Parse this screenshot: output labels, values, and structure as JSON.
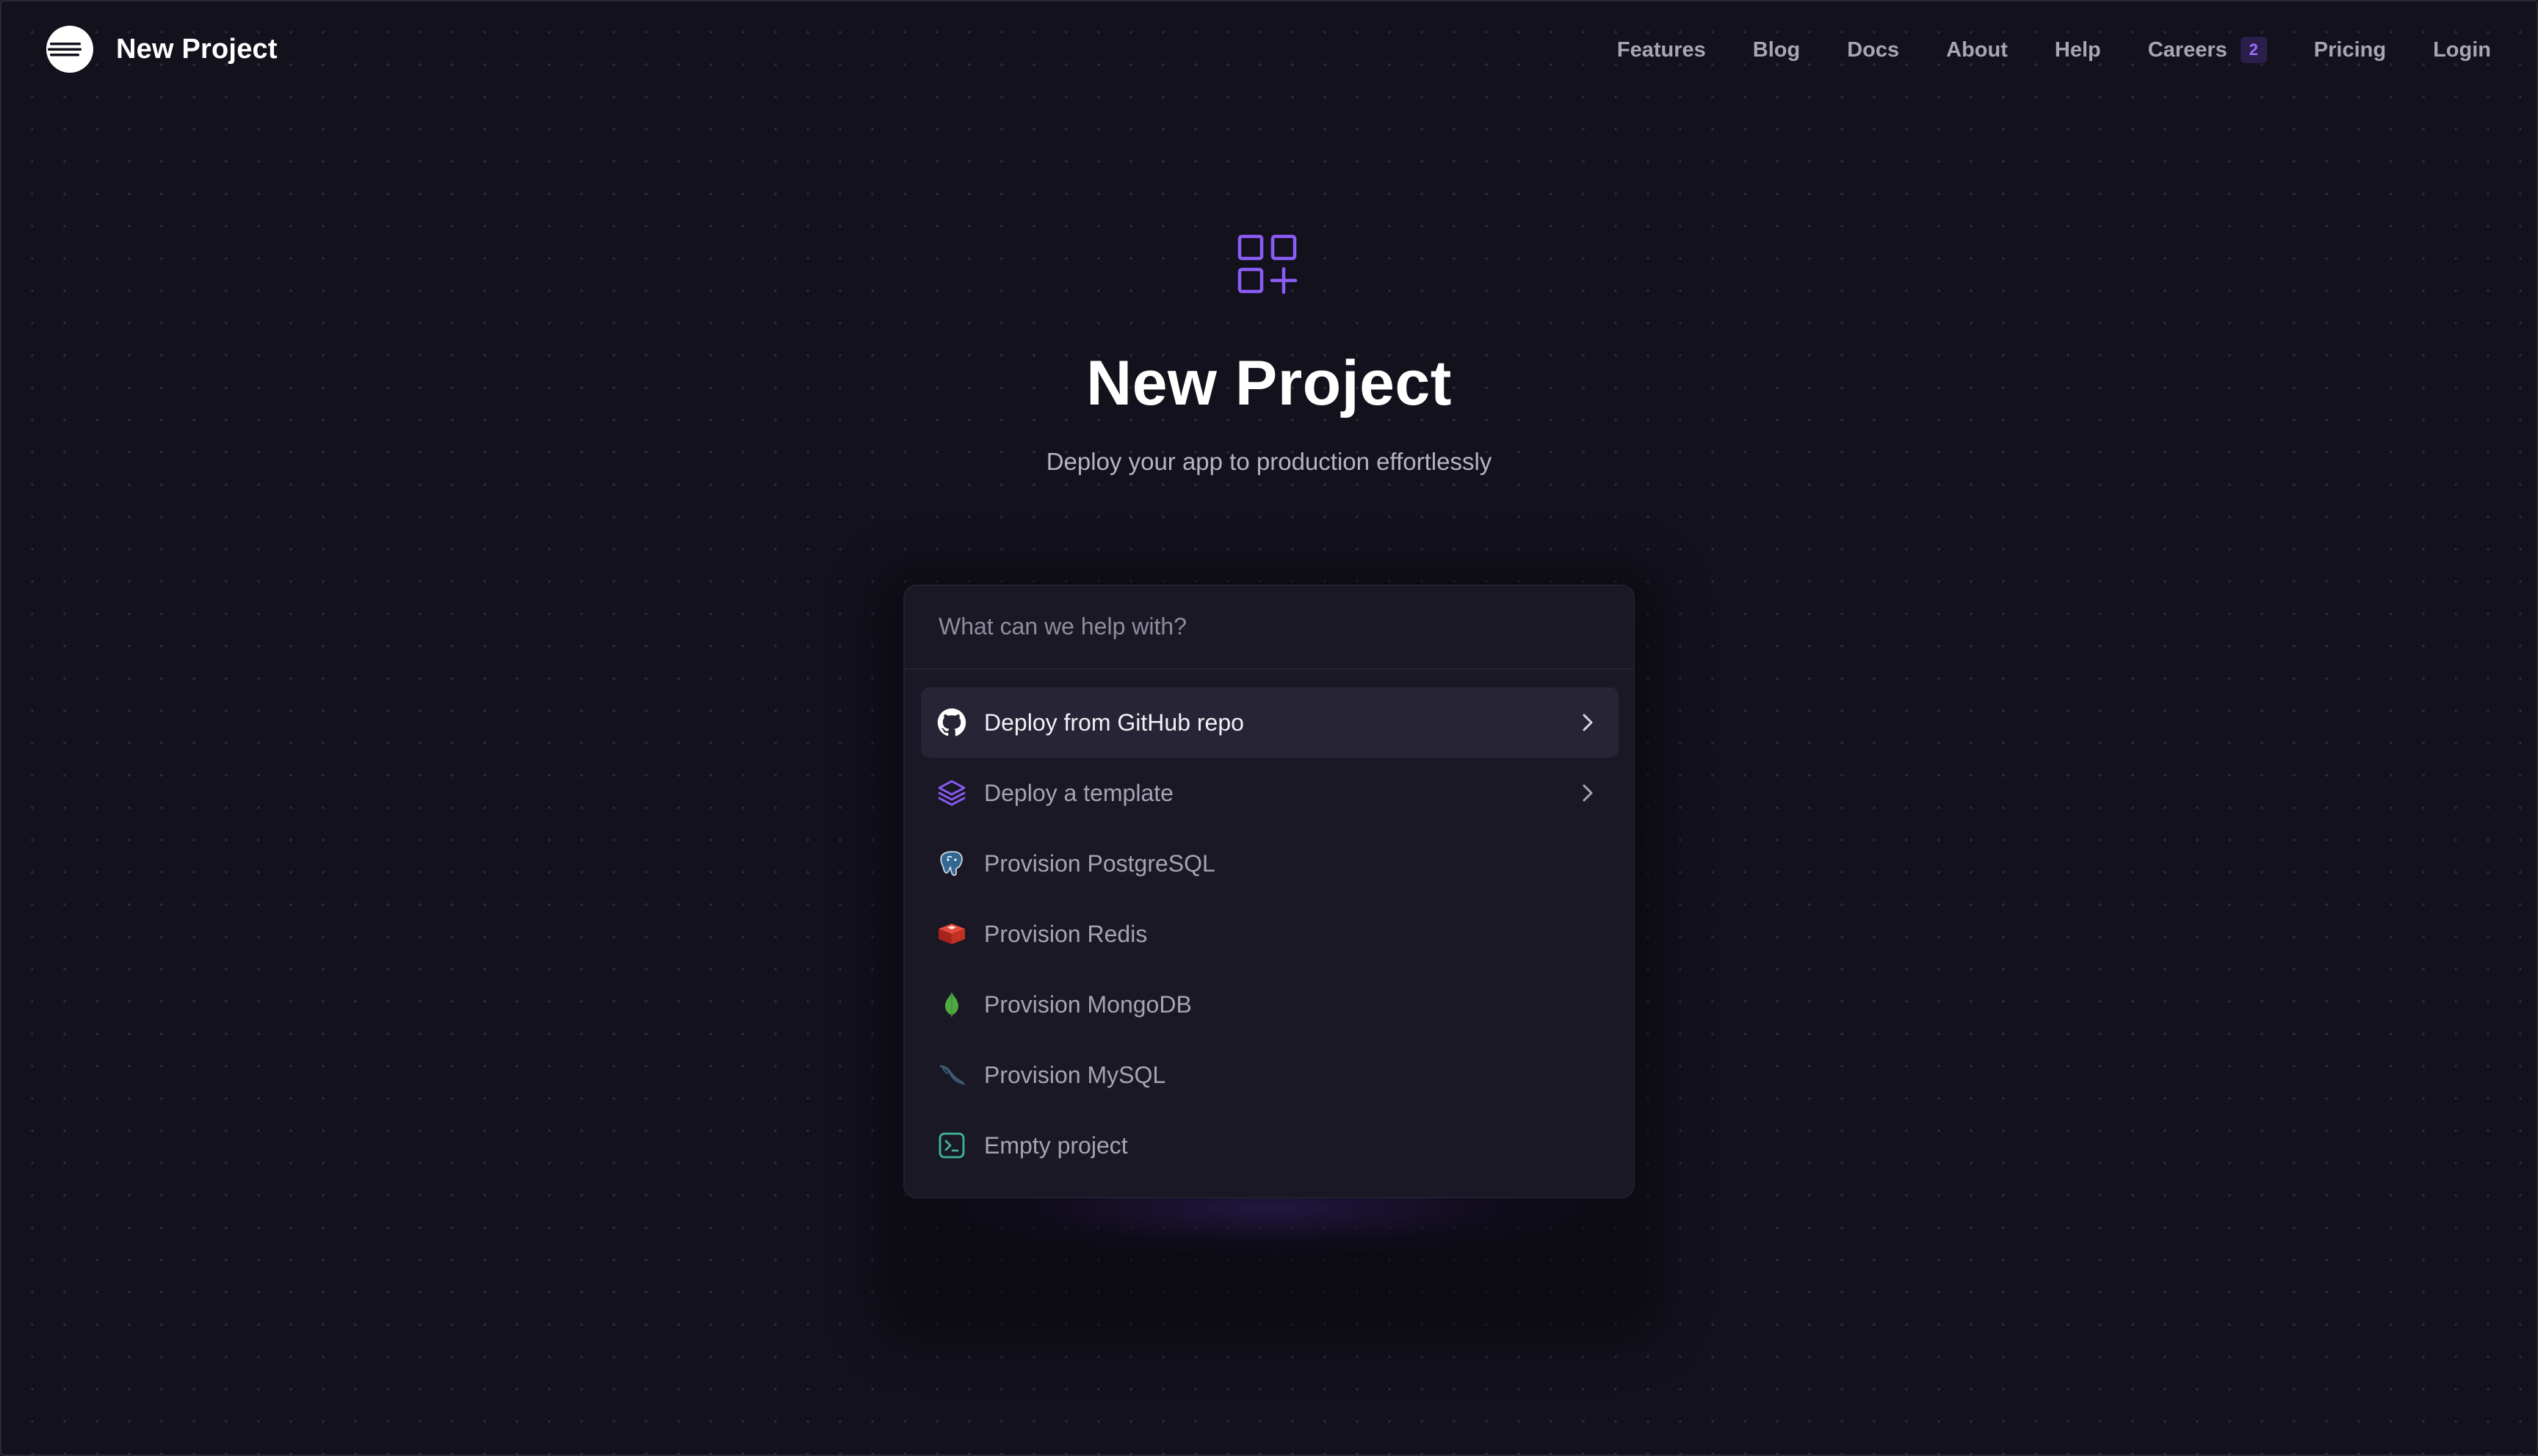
{
  "header": {
    "brand_name": "New Project",
    "nav": [
      {
        "label": "Features"
      },
      {
        "label": "Blog"
      },
      {
        "label": "Docs"
      },
      {
        "label": "About"
      },
      {
        "label": "Help"
      },
      {
        "label": "Careers",
        "badge": "2"
      },
      {
        "label": "Pricing"
      },
      {
        "label": "Login"
      }
    ]
  },
  "hero": {
    "icon": "grid-plus-icon",
    "title": "New Project",
    "subtitle": "Deploy your app to production effortlessly"
  },
  "search": {
    "placeholder": "What can we help with?",
    "value": ""
  },
  "options": [
    {
      "label": "Deploy from GitHub repo",
      "icon": "github-icon",
      "has_chevron": true,
      "active": true
    },
    {
      "label": "Deploy a template",
      "icon": "layers-icon",
      "has_chevron": true,
      "active": false
    },
    {
      "label": "Provision PostgreSQL",
      "icon": "postgresql-icon",
      "has_chevron": false,
      "active": false
    },
    {
      "label": "Provision Redis",
      "icon": "redis-icon",
      "has_chevron": false,
      "active": false
    },
    {
      "label": "Provision MongoDB",
      "icon": "mongodb-icon",
      "has_chevron": false,
      "active": false
    },
    {
      "label": "Provision MySQL",
      "icon": "mysql-icon",
      "has_chevron": false,
      "active": false
    },
    {
      "label": "Empty project",
      "icon": "terminal-icon",
      "has_chevron": false,
      "active": false
    }
  ],
  "colors": {
    "background": "#13111c",
    "panel": "#1a1825",
    "accent": "#8b5cf6",
    "active_row": "#272535",
    "nav_text": "#a8a6b3"
  }
}
